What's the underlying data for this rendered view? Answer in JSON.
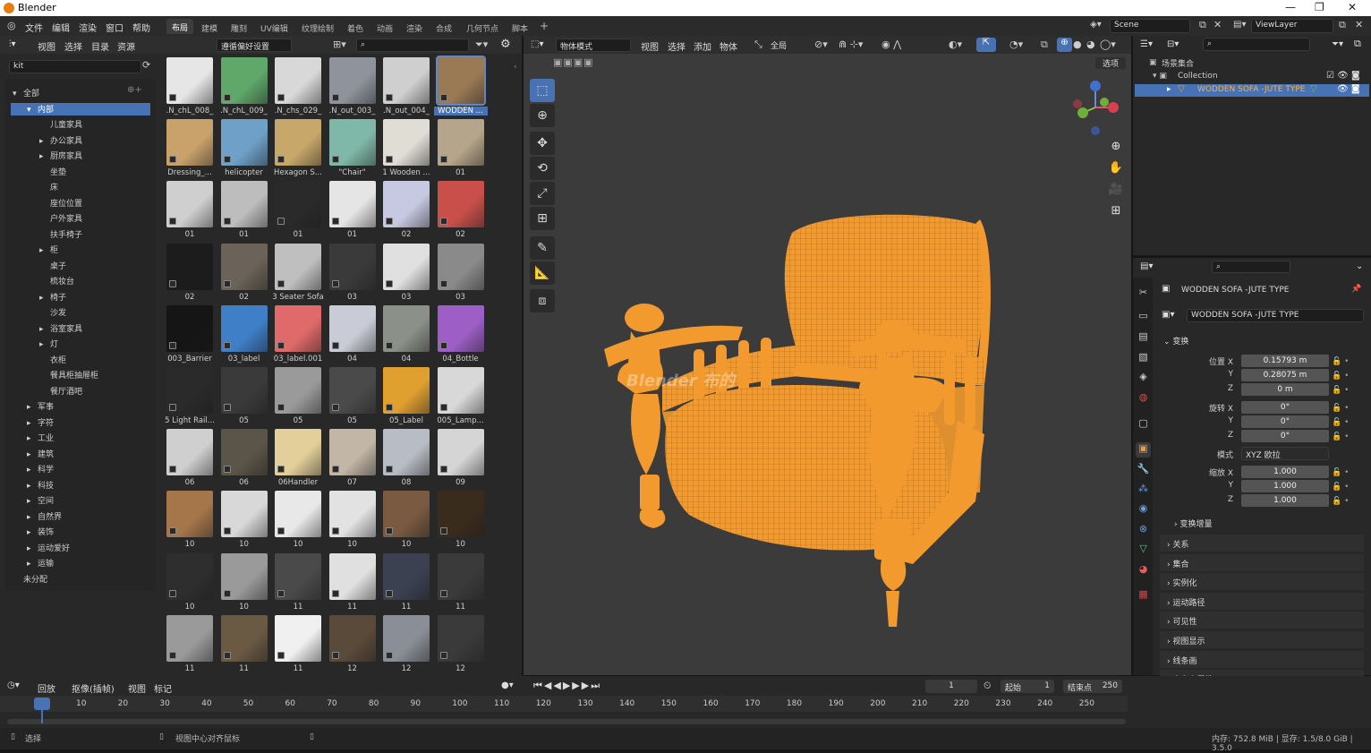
{
  "window": {
    "title": "Blender",
    "controls": [
      "—",
      "❐",
      "✕"
    ]
  },
  "topmenu": [
    "文件",
    "编辑",
    "渲染",
    "窗口",
    "帮助"
  ],
  "workspaces": [
    "布局",
    "建模",
    "雕刻",
    "UV编辑",
    "纹理绘制",
    "着色",
    "动画",
    "渲染",
    "合成",
    "几何节点",
    "脚本",
    "+"
  ],
  "scene": "Scene",
  "viewlayer": "ViewLayer",
  "asset_browser": {
    "menus": [
      "视图",
      "选择",
      "目录",
      "资源"
    ],
    "import": "遵循偏好设置",
    "filter": "kit",
    "tree": [
      {
        "label": "全部",
        "indent": 0,
        "arrow": "▾"
      },
      {
        "label": "内部",
        "indent": 1,
        "arrow": "▾",
        "sel": true
      },
      {
        "label": "儿童家具",
        "indent": 2,
        "arrow": ""
      },
      {
        "label": "办公家具",
        "indent": 2,
        "arrow": "▸"
      },
      {
        "label": "厨房家具",
        "indent": 2,
        "arrow": "▸"
      },
      {
        "label": "坐垫",
        "indent": 2,
        "arrow": ""
      },
      {
        "label": "床",
        "indent": 2,
        "arrow": ""
      },
      {
        "label": "座位位置",
        "indent": 2,
        "arrow": ""
      },
      {
        "label": "户外家具",
        "indent": 2,
        "arrow": ""
      },
      {
        "label": "扶手椅子",
        "indent": 2,
        "arrow": ""
      },
      {
        "label": "柜",
        "indent": 2,
        "arrow": "▸"
      },
      {
        "label": "桌子",
        "indent": 2,
        "arrow": ""
      },
      {
        "label": "梳妆台",
        "indent": 2,
        "arrow": ""
      },
      {
        "label": "椅子",
        "indent": 2,
        "arrow": "▸"
      },
      {
        "label": "沙发",
        "indent": 2,
        "arrow": ""
      },
      {
        "label": "浴室家具",
        "indent": 2,
        "arrow": "▸"
      },
      {
        "label": "灯",
        "indent": 2,
        "arrow": "▸"
      },
      {
        "label": "衣柜",
        "indent": 2,
        "arrow": ""
      },
      {
        "label": "餐具柜抽屉柜",
        "indent": 2,
        "arrow": ""
      },
      {
        "label": "餐厅酒吧",
        "indent": 2,
        "arrow": ""
      },
      {
        "label": "军事",
        "indent": 1,
        "arrow": "▸"
      },
      {
        "label": "字符",
        "indent": 1,
        "arrow": "▸"
      },
      {
        "label": "工业",
        "indent": 1,
        "arrow": "▸"
      },
      {
        "label": "建筑",
        "indent": 1,
        "arrow": "▸"
      },
      {
        "label": "科学",
        "indent": 1,
        "arrow": "▸"
      },
      {
        "label": "科技",
        "indent": 1,
        "arrow": "▸"
      },
      {
        "label": "空间",
        "indent": 1,
        "arrow": "▸"
      },
      {
        "label": "自然界",
        "indent": 1,
        "arrow": "▸"
      },
      {
        "label": "装饰",
        "indent": 1,
        "arrow": "▸"
      },
      {
        "label": "运动爱好",
        "indent": 1,
        "arrow": "▸"
      },
      {
        "label": "运输",
        "indent": 1,
        "arrow": "▸"
      },
      {
        "label": "未分配",
        "indent": 0,
        "arrow": ""
      }
    ],
    "assets": [
      {
        "label": ".N_chL_008_",
        "c": "#e6e6e6"
      },
      {
        "label": ".N_chL_009_",
        "c": "#5fa86a"
      },
      {
        "label": ".N_chs_029_",
        "c": "#d8d8d8"
      },
      {
        "label": ".N_out_003_",
        "c": "#8f949c"
      },
      {
        "label": ".N_out_004_",
        "c": "#cfcfcf"
      },
      {
        "label": "WODDEN ...",
        "c": "#9a7a55",
        "sel": true
      },
      {
        "label": "Dressing_...",
        "c": "#c9a26b"
      },
      {
        "label": "helicopter",
        "c": "#6fa0c8"
      },
      {
        "label": "Hexagon S...",
        "c": "#c8a86a"
      },
      {
        "label": "\"Chair\"",
        "c": "#7fb8a8"
      },
      {
        "label": "1 Wooden ...",
        "c": "#e0ddd5"
      },
      {
        "label": "01",
        "c": "#b5a58a"
      },
      {
        "label": "01",
        "c": "#cfcfcf"
      },
      {
        "label": "01",
        "c": "#bdbdbd"
      },
      {
        "label": "01",
        "c": "#2a2a2a"
      },
      {
        "label": "01",
        "c": "#e5e5e5"
      },
      {
        "label": "02",
        "c": "#c7c9e2"
      },
      {
        "label": "02",
        "c": "#c9504a"
      },
      {
        "label": "02",
        "c": "#1c1c1c"
      },
      {
        "label": "02",
        "c": "#6b6359"
      },
      {
        "label": "3 Seater Sofa",
        "c": "#bfbfbf"
      },
      {
        "label": "03",
        "c": "#3a3a3a"
      },
      {
        "label": "03",
        "c": "#e0e0e0"
      },
      {
        "label": "03",
        "c": "#8a8a8a"
      },
      {
        "label": "003_Barrier",
        "c": "#151515"
      },
      {
        "label": "03_label",
        "c": "#3f7fc8"
      },
      {
        "label": "03_label.001",
        "c": "#e06a6a"
      },
      {
        "label": "04",
        "c": "#c9ccd6"
      },
      {
        "label": "04",
        "c": "#8b9089"
      },
      {
        "label": "04_Bottle",
        "c": "#9d5fc6"
      },
      {
        "label": "5 Light Rail...",
        "c": "#2a2a2a"
      },
      {
        "label": "05",
        "c": "#3a3a3a"
      },
      {
        "label": "05",
        "c": "#9a9a9a"
      },
      {
        "label": "05",
        "c": "#4a4a4a"
      },
      {
        "label": "05_Label",
        "c": "#e0a030"
      },
      {
        "label": "005_Lamp...",
        "c": "#d8d8d8"
      },
      {
        "label": "06",
        "c": "#cfcfcf"
      },
      {
        "label": "06",
        "c": "#5a5548"
      },
      {
        "label": "06Handler",
        "c": "#e2cf9a"
      },
      {
        "label": "07",
        "c": "#c2b6a6"
      },
      {
        "label": "08",
        "c": "#b8bcc4"
      },
      {
        "label": "09",
        "c": "#d5d5d5"
      },
      {
        "label": "10",
        "c": "#a5764a"
      },
      {
        "label": "10",
        "c": "#d8d8d8"
      },
      {
        "label": "10",
        "c": "#e8e8e8"
      },
      {
        "label": "10",
        "c": "#e2e2e2"
      },
      {
        "label": "10",
        "c": "#7a5a40"
      },
      {
        "label": "10",
        "c": "#3a2c1c"
      },
      {
        "label": "10",
        "c": "#2e2e2e"
      },
      {
        "label": "10",
        "c": "#9a9a9a"
      },
      {
        "label": "11",
        "c": "#4a4a4a"
      },
      {
        "label": "11",
        "c": "#e0e0e0"
      },
      {
        "label": "11",
        "c": "#3c4152"
      },
      {
        "label": "11",
        "c": "#3a3a3a"
      },
      {
        "label": "11",
        "c": "#9a9a9a"
      },
      {
        "label": "11",
        "c": "#6a5a44"
      },
      {
        "label": "11",
        "c": "#f0f0f0"
      },
      {
        "label": "12",
        "c": "#5a4a3a"
      },
      {
        "label": "12",
        "c": "#8a8e96"
      },
      {
        "label": "12",
        "c": "#3a3a3a"
      }
    ]
  },
  "viewport": {
    "mode": "物体模式",
    "menus": [
      "视图",
      "选择",
      "添加",
      "物体"
    ],
    "transform": "全局",
    "select_btn": "选项",
    "watermark": "Blender 布的"
  },
  "outliner": {
    "scene_collection": "场景集合",
    "collection": "Collection",
    "object": "WODDEN SOFA -JUTE TYPE"
  },
  "properties": {
    "object_name": "WODDEN SOFA -JUTE TYPE",
    "data_name": "WODDEN SOFA -JUTE TYPE",
    "transform_label": "变换",
    "location_label": "位置 X",
    "loc": [
      "0.15793 m",
      "0.28075 m",
      "0 m"
    ],
    "rotation_label": "旋转 X",
    "rot": [
      "0°",
      "0°",
      "0°"
    ],
    "mode_label": "模式",
    "rot_mode": "XYZ 欧拉",
    "scale_label": "缩放 X",
    "scale": [
      "1.000",
      "1.000",
      "1.000"
    ],
    "axes": [
      "Y",
      "Z"
    ],
    "delta": "变换增量",
    "sections": [
      "关系",
      "集合",
      "实例化",
      "运动路径",
      "可见性",
      "视图显示",
      "线条画",
      "自定义属性"
    ]
  },
  "timeline": {
    "menus": [
      "回放",
      "抠像(插帧)",
      "视图",
      "标记"
    ],
    "current": "1",
    "start_label": "起始",
    "start": "1",
    "end_label": "结束点",
    "end": "250",
    "frames": [
      "1",
      "10",
      "20",
      "30",
      "40",
      "50",
      "60",
      "70",
      "80",
      "90",
      "100",
      "110",
      "120",
      "130",
      "140",
      "150",
      "160",
      "170",
      "180",
      "190",
      "200",
      "210",
      "220",
      "230",
      "240",
      "250"
    ]
  },
  "status": {
    "select": "选择",
    "center": "视图中心对齐鼠标",
    "info": "内存: 752.8 MiB | 显存: 1.5/8.0 GiB | 3.5.0"
  },
  "colors": {
    "accent": "#4772b3",
    "selection": "#f29a2e"
  }
}
